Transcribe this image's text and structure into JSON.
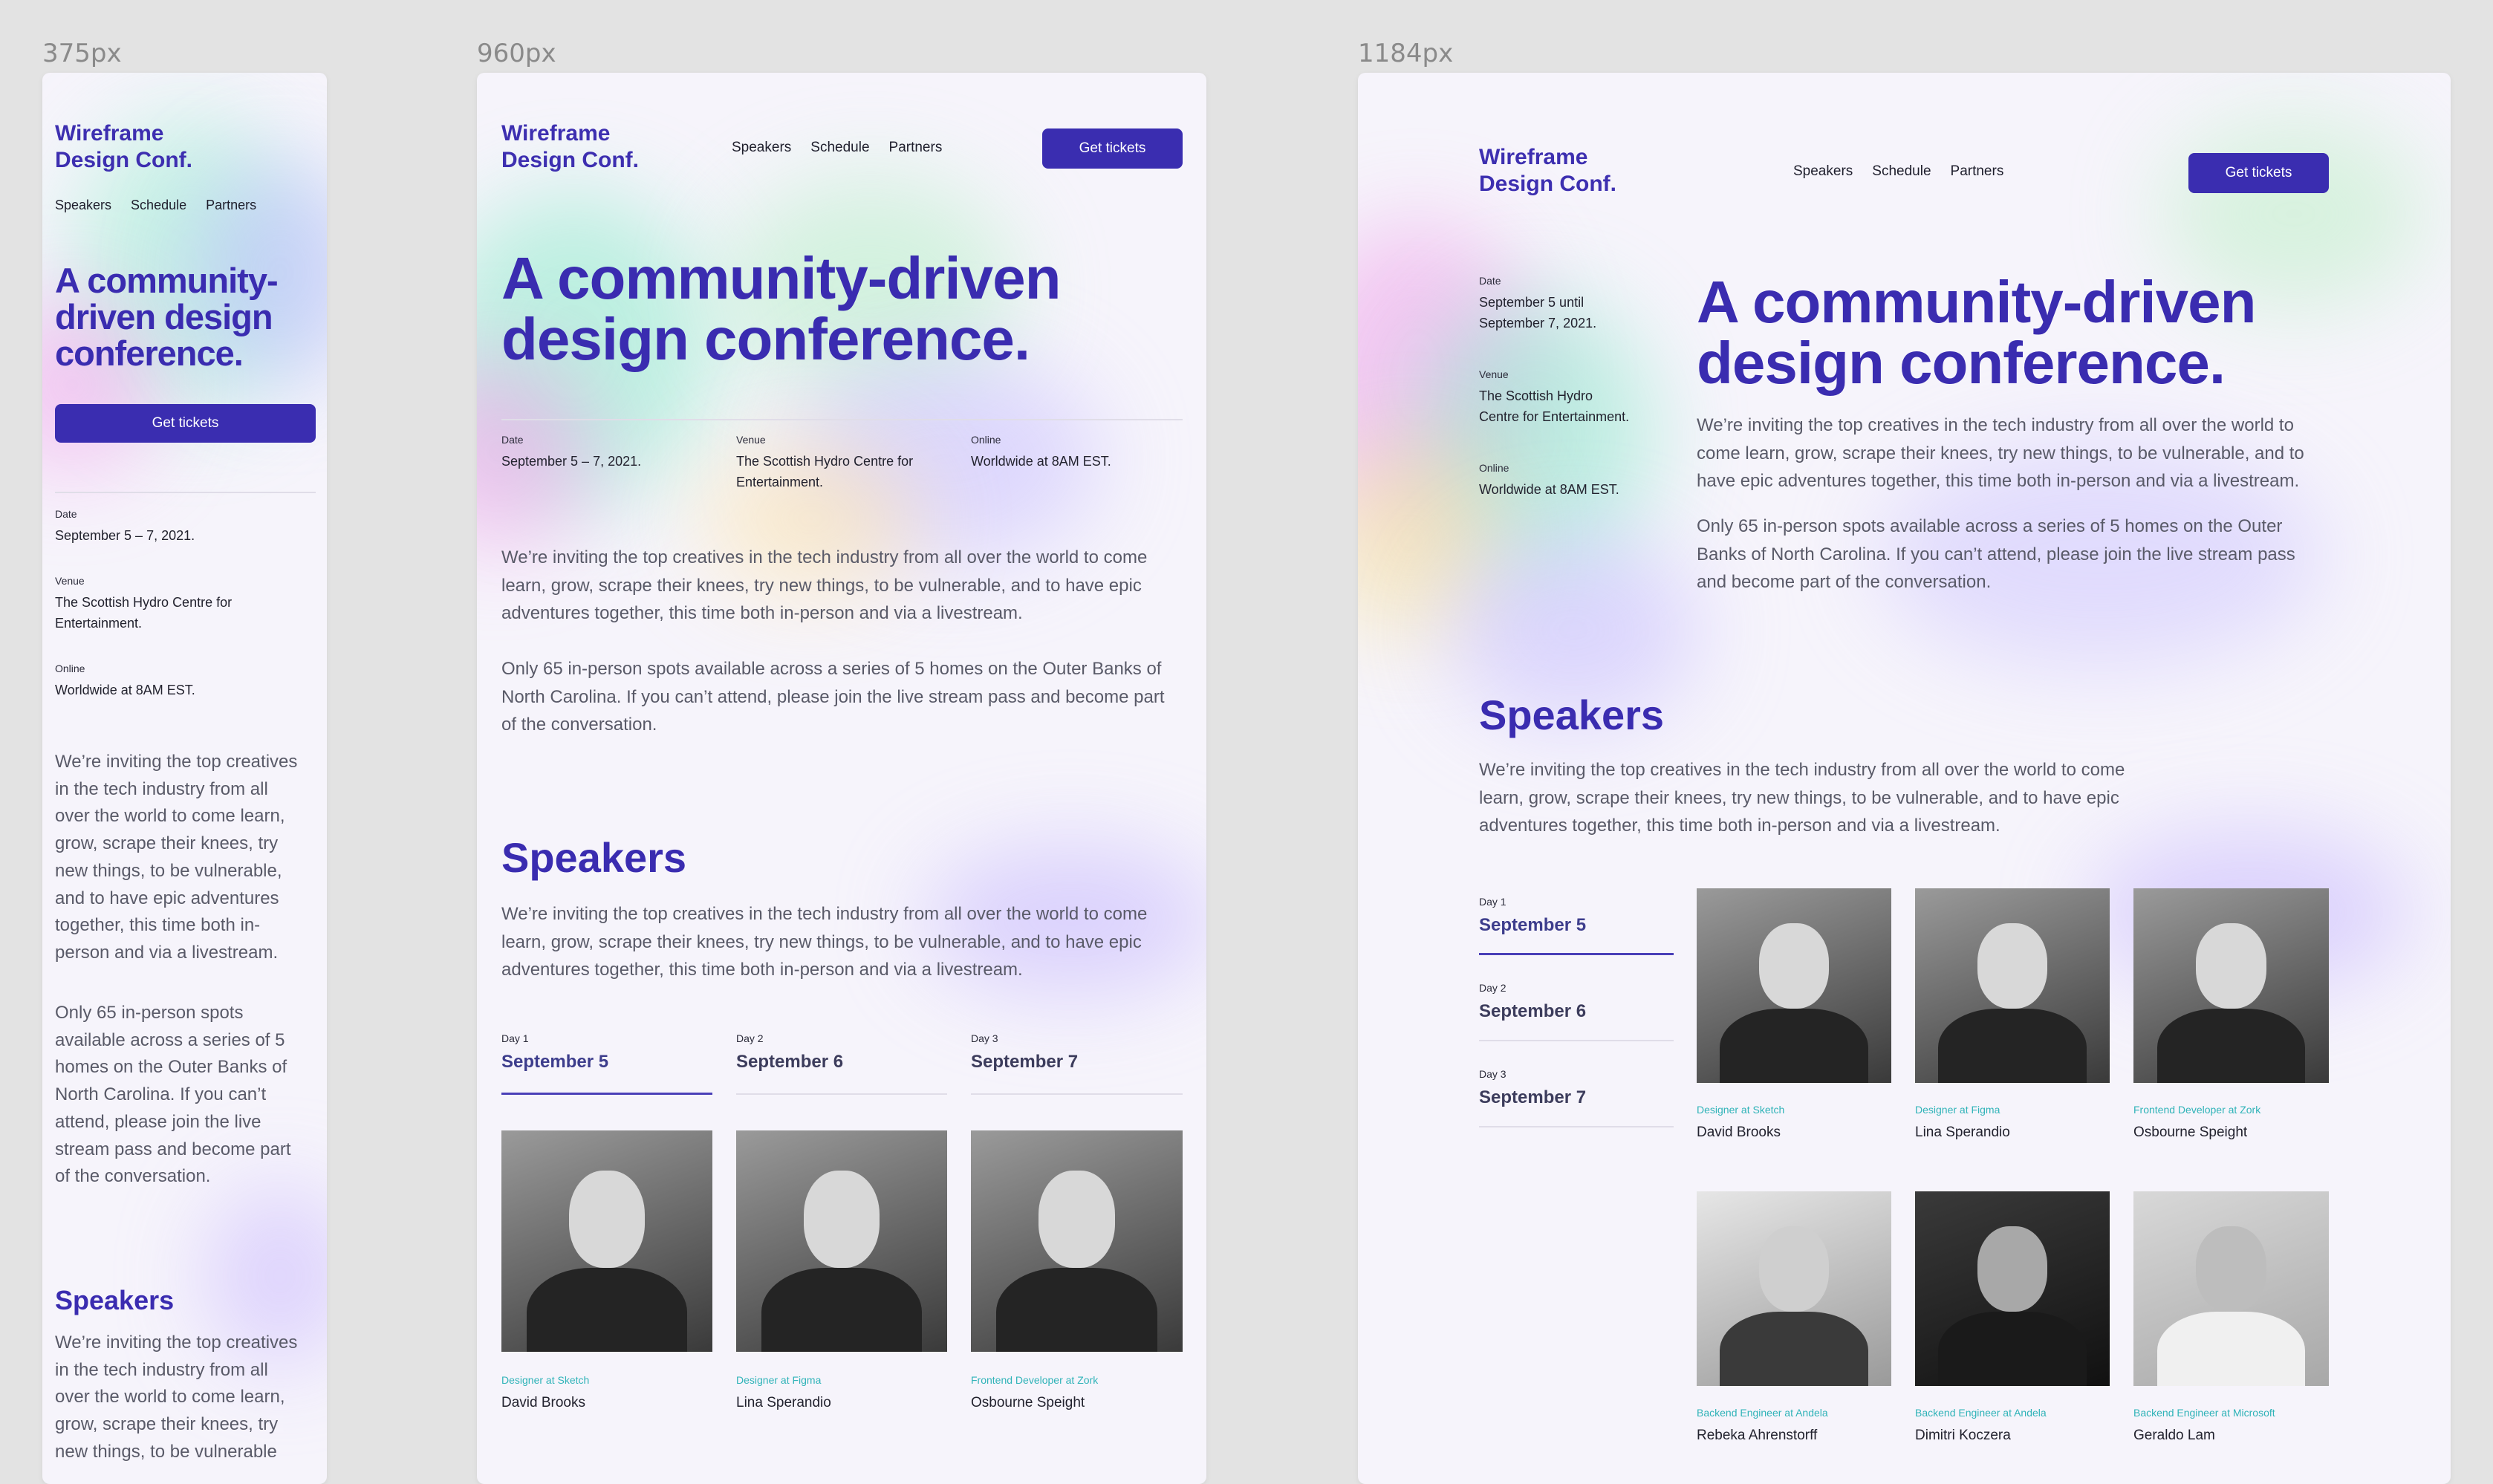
{
  "frame_labels": [
    "375px",
    "960px",
    "1184px"
  ],
  "brand": {
    "line1": "Wireframe",
    "line2": "Design Conf."
  },
  "nav": [
    "Speakers",
    "Schedule",
    "Partners"
  ],
  "cta": "Get tickets",
  "hero": {
    "line1": "A community-driven",
    "line2": "design conference.",
    "m1": "A community-",
    "m2": "driven design",
    "m3": "conference."
  },
  "info": {
    "date_label": "Date",
    "date_value": "September 5 – 7, 2021.",
    "date_value_l1": "September 5 until",
    "date_value_l2": "September 7, 2021.",
    "venue_label": "Venue",
    "venue_l1": "The Scottish Hydro Centre for",
    "venue_l2": "Entertainment.",
    "venue_w1": "The Scottish Hydro",
    "venue_w2": "Centre for Entertainment.",
    "online_label": "Online",
    "online_value": "Worldwide at 8AM EST."
  },
  "intro": "We’re inviting the top creatives in the tech industry from all over the world to come learn, grow, scrape their knees, try new things, to be vulnerable, and to have epic adventures together, this time both in-person and via a livestream.",
  "spots": "Only 65 in-person spots available across a series of 5 homes on the Outer Banks of North Carolina. If you can’t attend, please join the live stream pass and become part of the conversation.",
  "speakers": {
    "heading": "Speakers",
    "intro": "We’re inviting the top creatives in the tech industry from all over the world to come learn, grow, scrape their knees, try new things, to be vulnerable, and to have epic adventures together, this time both in-person and via a livestream.",
    "mobile_intro": "We’re inviting the top creatives in the tech industry from all over the world to come learn, grow, scrape their knees, try new things, to be vulnerable",
    "days": [
      {
        "day": "Day 1",
        "date": "September 5"
      },
      {
        "day": "Day 2",
        "date": "September 6"
      },
      {
        "day": "Day 3",
        "date": "September 7"
      }
    ],
    "people": [
      {
        "role": "Designer at Sketch",
        "name": "David Brooks"
      },
      {
        "role": "Designer at Figma",
        "name": "Lina Sperandio"
      },
      {
        "role": "Frontend Developer at Zork",
        "name": "Osbourne Speight"
      },
      {
        "role": "Backend Engineer at Andela",
        "name": "Rebeka Ahrenstorff"
      },
      {
        "role": "Backend Engineer at Andela",
        "name": "Dimitri Koczera"
      },
      {
        "role": "Backend Engineer at Microsoft",
        "name": "Geraldo Lam"
      }
    ]
  },
  "colors": {
    "accent": "#3a2cb0",
    "teal": "#2fb3b8",
    "bg": "#e3e3e3"
  }
}
